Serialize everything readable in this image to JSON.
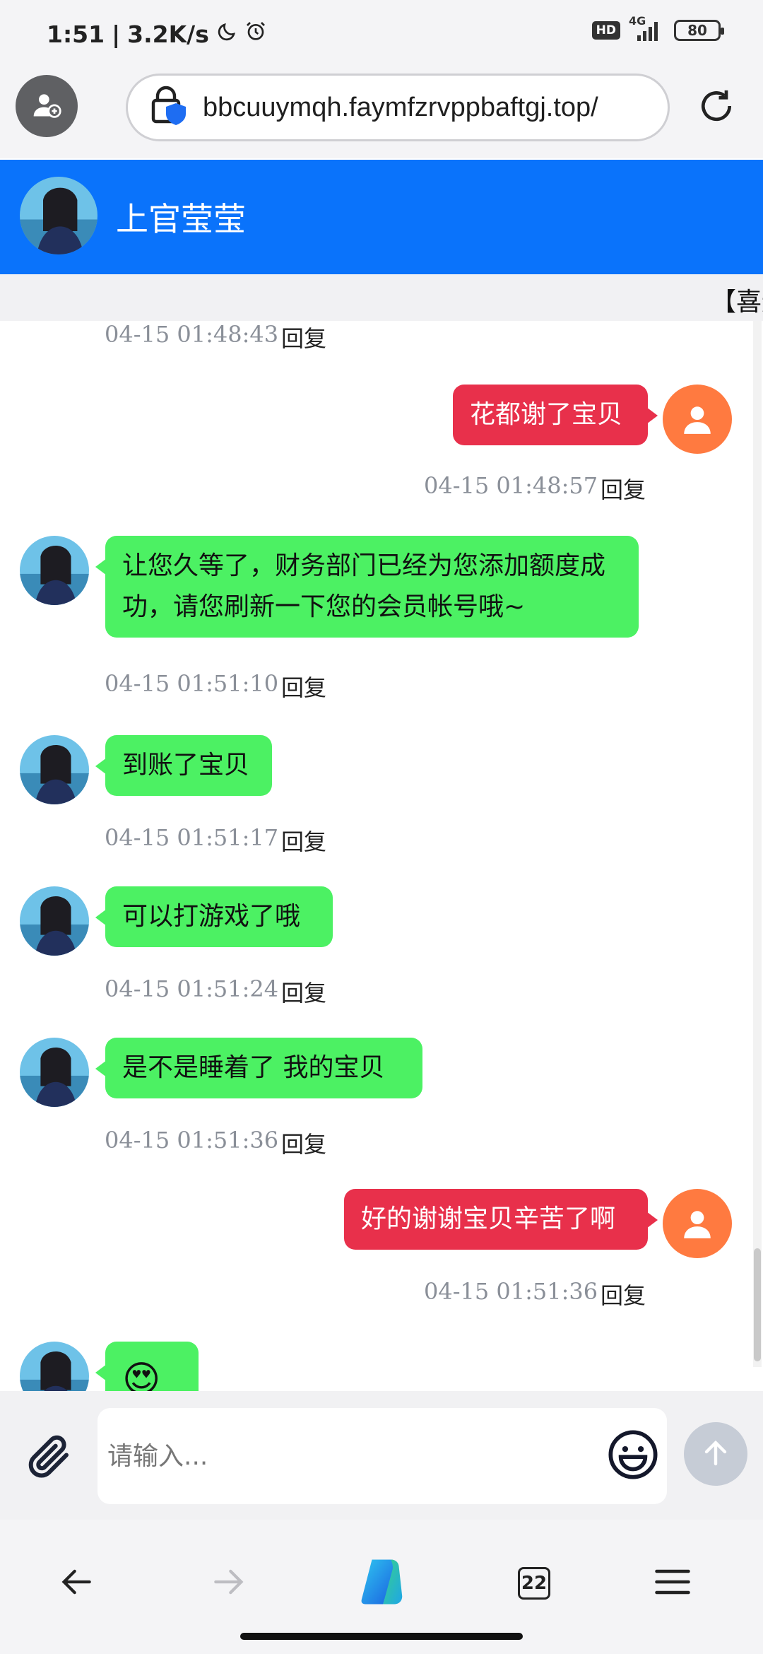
{
  "status_bar": {
    "time": "1:51",
    "separator": "|",
    "speed": "3.2K/s",
    "hd_badge": "HD",
    "network": "4G",
    "battery": "80"
  },
  "browser": {
    "url": "bbcuuymqh.faymfzrvppbaftgj.top/",
    "tab_count": "22"
  },
  "chat": {
    "contact_name": "上官莹莹",
    "marquee": "【喜迎",
    "reply_label": "回复",
    "messages": [
      {
        "side": "left",
        "text": "",
        "time": "04-15 01:48:43"
      },
      {
        "side": "right",
        "text": "花都谢了宝贝",
        "time": "04-15 01:48:57"
      },
      {
        "side": "left",
        "text": "让您久等了，财务部门已经为您添加额度成功，请您刷新一下您的会员帐号哦~",
        "time": "04-15 01:51:10"
      },
      {
        "side": "left",
        "text": "到账了宝贝",
        "time": "04-15 01:51:17"
      },
      {
        "side": "left",
        "text": "可以打游戏了哦",
        "time": "04-15 01:51:24"
      },
      {
        "side": "left",
        "text": "是不是睡着了 我的宝贝",
        "time": "04-15 01:51:36"
      },
      {
        "side": "right",
        "text": "好的谢谢宝贝辛苦了啊",
        "time": "04-15 01:51:36"
      },
      {
        "side": "left",
        "text": "😍",
        "time": ""
      }
    ]
  },
  "composer": {
    "placeholder": "请输入..."
  },
  "colors": {
    "header_blue": "#0a73fb",
    "contact_bubble": "#4cf163",
    "user_bubble": "#e8304b",
    "user_avatar": "#ff7a40",
    "send_button": "#c6ccd6"
  },
  "icons": {
    "profile": "profile-add-icon",
    "site_security": "shield-lock-icon",
    "refresh": "refresh-icon",
    "attach": "paperclip-icon",
    "emoji": "smiley-icon",
    "send": "arrow-up-icon",
    "back": "arrow-left-icon",
    "forward": "arrow-right-icon",
    "copilot": "copilot-icon",
    "menu": "hamburger-menu-icon"
  }
}
